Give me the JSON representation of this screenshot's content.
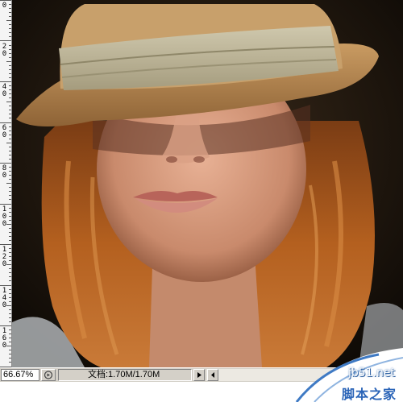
{
  "ruler": {
    "labels": [
      "0",
      "2\n0",
      "4\n0",
      "6\n0",
      "8\n0",
      "1\n0\n0",
      "1\n2\n0",
      "1\n4\n0",
      "1\n6\n0"
    ]
  },
  "status": {
    "zoom": "66.67%",
    "doc_label": "文档:1.70M/1.70M"
  },
  "watermark": {
    "url": "jb51.net",
    "brand": "脚本之家"
  }
}
